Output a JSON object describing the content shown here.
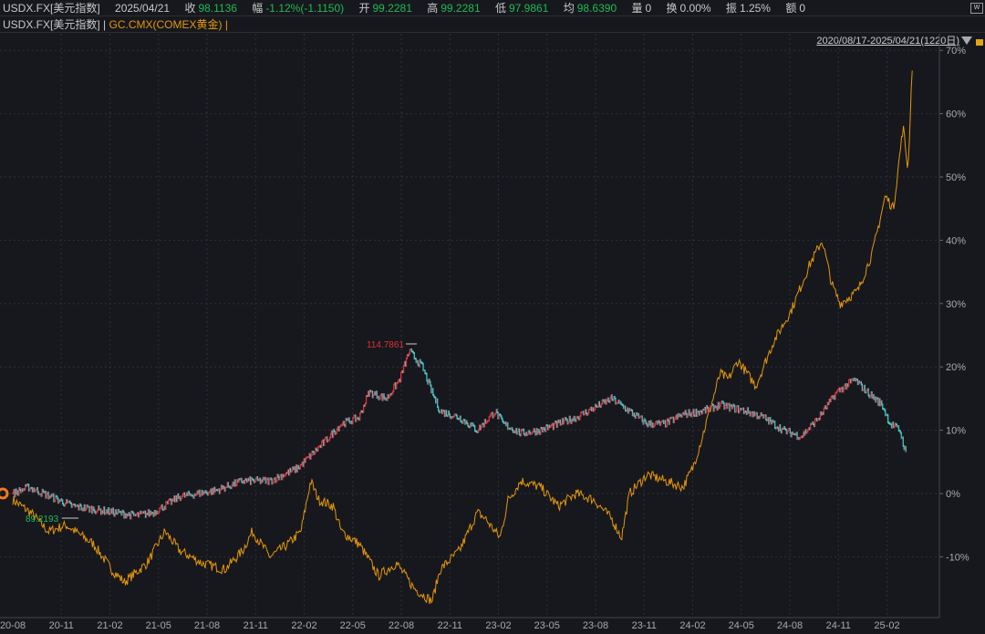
{
  "header": {
    "symbol": "USDX.FX[美元指数]",
    "date": "2025/04/21",
    "close_label": "收",
    "close": "98.1136",
    "change_label": "幅",
    "change": "-1.12%(-1.1150)",
    "open_label": "开",
    "open": "99.2281",
    "high_label": "高",
    "high": "99.2281",
    "low_label": "低",
    "low": "97.9861",
    "avg_label": "均",
    "avg": "98.6390",
    "vol_label": "量",
    "vol": "0",
    "turnover_label": "换",
    "turnover": "0.00%",
    "amp_label": "振",
    "amp": "1.25%",
    "amount_label": "额",
    "amount": "0"
  },
  "legend": {
    "main": "USDX.FX[美元指数] |",
    "compare": "GC.CMX(COMEX黄金) |",
    "range": "2020/08/17-2025/04/21(1220日)",
    "w_icon": "W"
  },
  "colors": {
    "up": "#e0303a",
    "down": "#3cc8c8",
    "gold": "#e5960c",
    "green": "#1fb954"
  },
  "chart_data": {
    "type": "line",
    "xlabel": "",
    "ylabel": "",
    "x_ticks": [
      "20-08",
      "20-11",
      "21-02",
      "21-05",
      "21-08",
      "21-11",
      "22-02",
      "22-05",
      "22-08",
      "22-11",
      "23-02",
      "23-05",
      "23-08",
      "23-11",
      "24-02",
      "24-05",
      "24-08",
      "24-11",
      "25-02"
    ],
    "y_ticks": [
      "70%",
      "60%",
      "50%",
      "40%",
      "30%",
      "20%",
      "10%",
      "0%",
      "-10%"
    ],
    "ylim": [
      -18,
      72
    ],
    "x_range_months": [
      0,
      56
    ],
    "series": [
      {
        "name": "USDX.FX",
        "points": [
          [
            0,
            0
          ],
          [
            1,
            1
          ],
          [
            3.7,
            -2
          ],
          [
            7.6,
            -3.5
          ],
          [
            8.7,
            -3
          ],
          [
            10.3,
            -0.5
          ],
          [
            12.6,
            0.5
          ],
          [
            14.2,
            2
          ],
          [
            15.9,
            2
          ],
          [
            17.6,
            4
          ],
          [
            19.2,
            8
          ],
          [
            20.3,
            11
          ],
          [
            21.4,
            12
          ],
          [
            22,
            16
          ],
          [
            23.1,
            15
          ],
          [
            23.9,
            18
          ],
          [
            24.5,
            22.5
          ],
          [
            25.3,
            20
          ],
          [
            25.9,
            16
          ],
          [
            26.4,
            13
          ],
          [
            27.6,
            12
          ],
          [
            28.7,
            10
          ],
          [
            29.8,
            13
          ],
          [
            30.3,
            11
          ],
          [
            31.4,
            9.5
          ],
          [
            32.6,
            10
          ],
          [
            33.7,
            11
          ],
          [
            34.8,
            12
          ],
          [
            35.9,
            13.5
          ],
          [
            37,
            15
          ],
          [
            38.1,
            13
          ],
          [
            39.2,
            11
          ],
          [
            40.3,
            11
          ],
          [
            41.4,
            12.5
          ],
          [
            42.6,
            13
          ],
          [
            43.7,
            14
          ],
          [
            45.3,
            13
          ],
          [
            46.4,
            12
          ],
          [
            47.6,
            10
          ],
          [
            48.7,
            9
          ],
          [
            49.8,
            12
          ],
          [
            50.9,
            16
          ],
          [
            52,
            18
          ],
          [
            52.8,
            16
          ],
          [
            53.7,
            14
          ],
          [
            54.2,
            11
          ],
          [
            54.8,
            10
          ],
          [
            55.2,
            6
          ]
        ]
      },
      {
        "name": "GC.CMX",
        "points": [
          [
            0,
            -1
          ],
          [
            1.1,
            -3
          ],
          [
            2.2,
            -6
          ],
          [
            3.3,
            -5
          ],
          [
            5,
            -8
          ],
          [
            6.1,
            -12
          ],
          [
            6.9,
            -14
          ],
          [
            8.3,
            -11
          ],
          [
            9.4,
            -6
          ],
          [
            10.3,
            -9
          ],
          [
            11.7,
            -11
          ],
          [
            13.1,
            -12
          ],
          [
            14.2,
            -9
          ],
          [
            14.8,
            -6
          ],
          [
            15.9,
            -10
          ],
          [
            17,
            -8
          ],
          [
            17.8,
            -6
          ],
          [
            18.4,
            2
          ],
          [
            18.9,
            -1
          ],
          [
            19.8,
            -2
          ],
          [
            20.3,
            -6
          ],
          [
            21.4,
            -8
          ],
          [
            22.6,
            -13
          ],
          [
            23.7,
            -11
          ],
          [
            24.8,
            -15
          ],
          [
            25.9,
            -17
          ],
          [
            26.4,
            -12
          ],
          [
            27.6,
            -9
          ],
          [
            28.7,
            -3
          ],
          [
            29.2,
            -4
          ],
          [
            30.1,
            -7
          ],
          [
            30.6,
            -1
          ],
          [
            31.4,
            2
          ],
          [
            32.6,
            1
          ],
          [
            33.7,
            -2
          ],
          [
            34.8,
            0
          ],
          [
            35.9,
            -1
          ],
          [
            37,
            -4
          ],
          [
            37.6,
            -7
          ],
          [
            38.1,
            0
          ],
          [
            39.2,
            3
          ],
          [
            40.3,
            2
          ],
          [
            41.4,
            1
          ],
          [
            42,
            4
          ],
          [
            42.6,
            9
          ],
          [
            43.7,
            19
          ],
          [
            44.2,
            18
          ],
          [
            44.8,
            21
          ],
          [
            45.9,
            17
          ],
          [
            47,
            24
          ],
          [
            48.1,
            29
          ],
          [
            49.2,
            36
          ],
          [
            50,
            40
          ],
          [
            50.6,
            33
          ],
          [
            51.1,
            30
          ],
          [
            52.2,
            32
          ],
          [
            53.1,
            38
          ],
          [
            53.9,
            47
          ],
          [
            54.4,
            45
          ],
          [
            55,
            58
          ],
          [
            55.3,
            51
          ],
          [
            55.6,
            70
          ]
        ]
      }
    ],
    "annotations": {
      "max": "114.7861",
      "min": "89.2193"
    }
  }
}
